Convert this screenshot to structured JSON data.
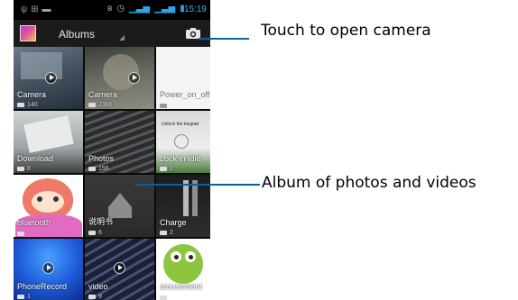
{
  "status_bar": {
    "time": "15:19",
    "left_icons": [
      "usb-icon",
      "android-debug-icon",
      "sd-card-icon"
    ],
    "right_icons": [
      "bluetooth-icon",
      "alarm-icon",
      "signal-icon",
      "signal-icon",
      "battery-icon"
    ]
  },
  "action_bar": {
    "title": "Albums",
    "app_icon": "gallery-app-icon",
    "camera_icon": "camera-icon"
  },
  "albums": [
    {
      "name": "Camera",
      "count": "140",
      "count_icon": "camera-icon",
      "video": true
    },
    {
      "name": "Camera",
      "count": "2386",
      "count_icon": "folder-icon",
      "video": true
    },
    {
      "name": "Power_on_off",
      "count": "",
      "count_icon": "folder-icon",
      "video": false
    },
    {
      "name": "Download",
      "count": "8",
      "count_icon": "folder-icon",
      "video": false
    },
    {
      "name": "Photos",
      "count": "156",
      "count_icon": "folder-icon",
      "video": false
    },
    {
      "name": "Lock in Idle",
      "count": "2",
      "count_icon": "folder-icon",
      "video": false,
      "overlay_text": "Unlock the keypad"
    },
    {
      "name": "bluetooth",
      "count": "",
      "count_icon": "folder-icon",
      "video": false
    },
    {
      "name": "说明书",
      "count": "6",
      "count_icon": "folder-icon",
      "video": false
    },
    {
      "name": "Charge",
      "count": "2",
      "count_icon": "folder-icon",
      "video": false
    },
    {
      "name": "PhoneRecord",
      "count": "1",
      "count_icon": "folder-icon",
      "video": true
    },
    {
      "name": "video",
      "count": "9",
      "count_icon": "folder-icon",
      "video": true
    },
    {
      "name": "amusement",
      "count": "",
      "count_icon": "folder-icon",
      "video": false
    }
  ],
  "callouts": {
    "camera": "Touch to open camera",
    "album": "Album of photos and videos"
  },
  "colors": {
    "callout_line": "#0a5fa8",
    "status_accent": "#33b5e5"
  }
}
